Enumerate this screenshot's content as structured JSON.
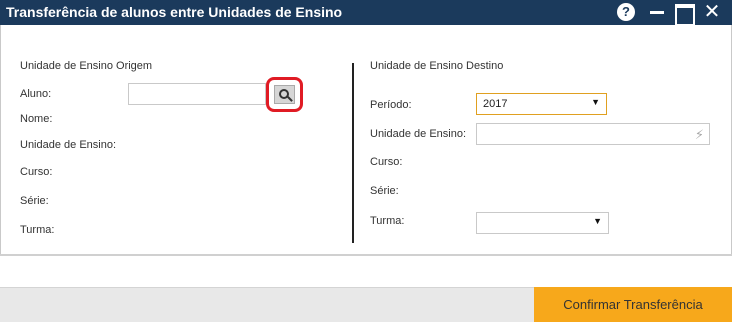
{
  "window": {
    "title": "Transferência de alunos entre Unidades de Ensino",
    "help": "?",
    "close": "✕"
  },
  "origem": {
    "section_title": "Unidade de Ensino Origem",
    "aluno_label": "Aluno:",
    "aluno_value": "",
    "nome_label": "Nome:",
    "unidade_label": "Unidade de Ensino:",
    "curso_label": "Curso:",
    "serie_label": "Série:",
    "turma_label": "Turma:"
  },
  "destino": {
    "section_title": "Unidade de Ensino Destino",
    "periodo_label": "Período:",
    "periodo_value": "2017",
    "unidade_label": "Unidade de Ensino:",
    "unidade_value": "",
    "curso_label": "Curso:",
    "serie_label": "Série:",
    "turma_label": "Turma:",
    "turma_value": ""
  },
  "footer": {
    "confirm_label": "Confirmar Transferência"
  },
  "icons": {
    "caret": "▼",
    "bolt": "⚡"
  },
  "colors": {
    "titlebar": "#1b3a5c",
    "confirm": "#f7a81b",
    "highlight": "#e01b24"
  }
}
